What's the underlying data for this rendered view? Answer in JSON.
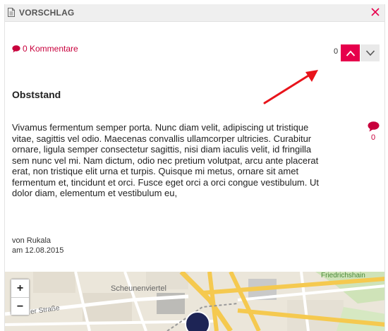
{
  "header": {
    "title": "VORSCHLAG",
    "icon": "document-icon",
    "close_icon": "close-icon"
  },
  "comments": {
    "label": "0 Kommentare",
    "icon": "speech-bubble-icon"
  },
  "voting": {
    "count": "0",
    "up_icon": "chevron-up-icon",
    "down_icon": "chevron-down-icon"
  },
  "proposal": {
    "title": "Obststand",
    "body": "Vivamus fermentum semper porta. Nunc diam velit, adipiscing ut tristique vitae, sagittis vel odio. Maecenas convallis ullamcorper ultricies. Curabitur ornare, ligula semper consectetur sagittis, nisi diam iaculis velit, id fringilla sem nunc vel mi. Nam dictum, odio nec pretium volutpat, arcu ante placerat erat, non tristique elit urna et turpis. Quisque mi metus, ornare sit amet fermentum et, tincidunt et orci. Fusce eget orci a orci congue vestibulum. Ut dolor diam, elementum et vestibulum eu,",
    "side_comment_count": "0",
    "author": "von Rukala",
    "date": "am 12.08.2015"
  },
  "map": {
    "zoom_in": "+",
    "zoom_out": "−",
    "labels": {
      "district": "Scheunenviertel",
      "area": "Friedrichshain",
      "street": "er Straße"
    }
  },
  "colors": {
    "accent": "#e6004c",
    "link": "#c8003c",
    "marker": "#1d2455",
    "annotation_arrow": "#e8141b"
  }
}
